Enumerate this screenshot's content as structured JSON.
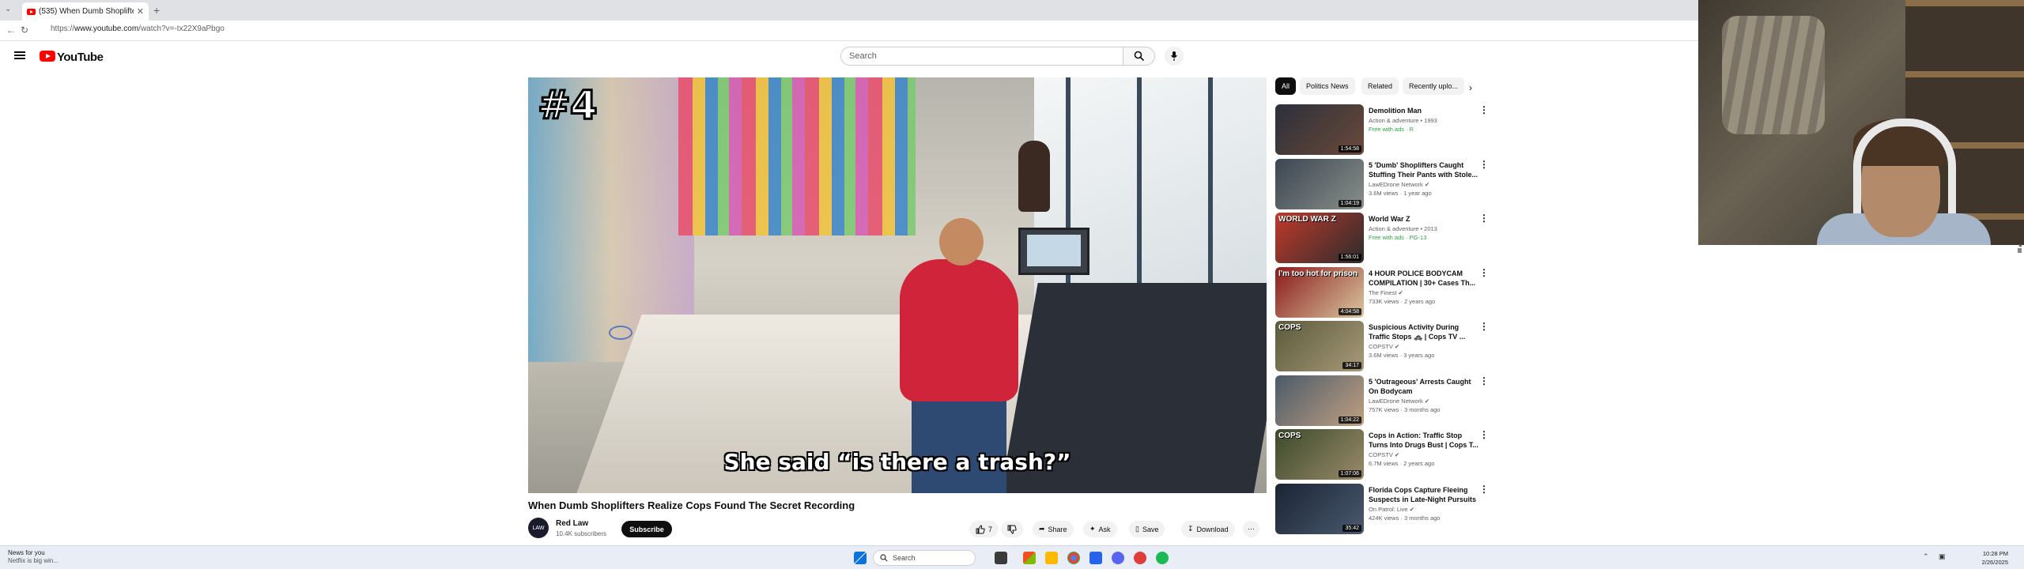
{
  "browser": {
    "tab_title": "(535) When Dumb Shoplifters Realiz...",
    "url_prefix": "https://",
    "url_domain": "www.youtube.com",
    "url_path": "/watch?v=-tx22X9aPbgo"
  },
  "header": {
    "logo_text": "YouTube",
    "search_placeholder": "Search"
  },
  "player": {
    "overlay_rank": "#4",
    "caption": "She said “is there a trash?”"
  },
  "video": {
    "title": "When Dumb Shoplifters Realize Cops Found The Secret Recording",
    "channel_name": "Red Law",
    "channel_avatar": "LAW",
    "subscribers": "10.4K subscribers",
    "subscribe_label": "Subscribe",
    "like_count": "7",
    "share_label": "Share",
    "ask_label": "Ask",
    "save_label": "Save",
    "download_label": "Download"
  },
  "chips": [
    "All",
    "Politics News",
    "Related",
    "Recently uplo..."
  ],
  "recommendations": [
    {
      "title": "Demolition Man",
      "line1": "Action & adventure • 1993",
      "free": "Free with ads · R",
      "duration": "1:54:58",
      "thumb_text": "",
      "color1": "#2b2f3a",
      "color2": "#6b4a3a"
    },
    {
      "title": "5 'Dumb' Shoplifters Caught Stuffing Their Pants with Stole...",
      "line1": "LawEDrone Network ✔",
      "line2": "3.6M views · 1 year ago",
      "duration": "1:04:19",
      "thumb_text": "",
      "color1": "#3b4652",
      "color2": "#8a8f8a"
    },
    {
      "title": "World War Z",
      "line1": "Action & adventure • 2013",
      "free": "Free with ads · PG-13",
      "duration": "1:56:01",
      "thumb_text": "WORLD WAR Z",
      "color1": "#c0392b",
      "color2": "#2c2c2c"
    },
    {
      "title": "4 HOUR POLICE BODYCAM COMPILATION | 30+ Cases Th...",
      "line1": "The Finest ✔",
      "line2": "733K views · 2 years ago",
      "duration": "4:04:58",
      "thumb_text": "I'm too hot for prison",
      "color1": "#8b1a1a",
      "color2": "#d9c7a0"
    },
    {
      "title": "Suspicious Activity During Traffic Stops 🚓 | Cops TV ...",
      "line1": "COPSTV ✔",
      "line2": "3.6M views · 3 years ago",
      "duration": "34:17",
      "thumb_text": "COPS",
      "color1": "#5a5a3a",
      "color2": "#a89a7a"
    },
    {
      "title": "5 'Outrageous' Arrests Caught On Bodycam",
      "line1": "LawEDrone Network ✔",
      "line2": "757K views · 3 months ago",
      "duration": "1:04:22",
      "thumb_text": "",
      "color1": "#4a5a6a",
      "color2": "#c0a080"
    },
    {
      "title": "Cops in Action: Traffic Stop Turns Into Drugs Bust | Cops T...",
      "line1": "COPSTV ✔",
      "line2": "6.7M views · 2 years ago",
      "duration": "1:07:06",
      "thumb_text": "COPS",
      "color1": "#3a4a2a",
      "color2": "#9a8a6a"
    },
    {
      "title": "Florida Cops Capture Fleeing Suspects in Late-Night Pursuits",
      "line1": "On Patrol: Live ✔",
      "line2": "424K views · 3 months ago",
      "duration": "35:42",
      "thumb_text": "",
      "color1": "#1a2433",
      "color2": "#4a5a70"
    }
  ],
  "taskbar": {
    "weather_line1": "News for you",
    "weather_line2": "Netflix is big win...",
    "search_label": "Search",
    "time": "10:28 PM",
    "date": "2/26/2025"
  },
  "colors": {
    "youtube_red": "#ff0000",
    "subscribe_bg": "#0f0f0f",
    "free_green": "#2ba640"
  }
}
